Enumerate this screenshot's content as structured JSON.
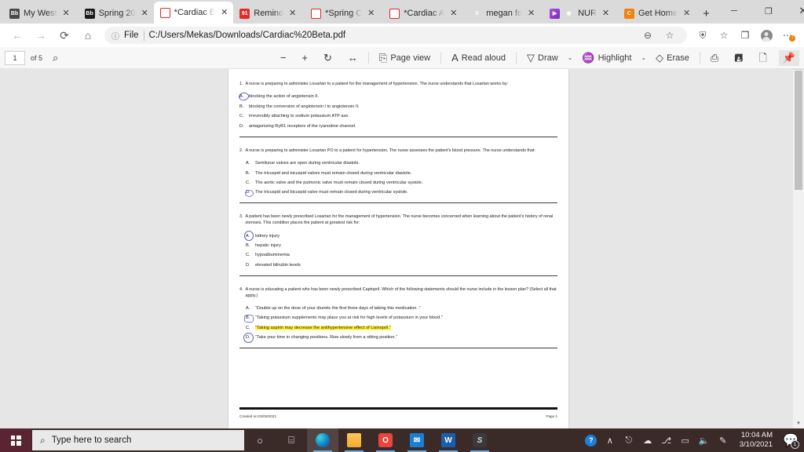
{
  "browser": {
    "tabs": [
      {
        "title": "My West ",
        "icon": "blackboard-icon",
        "icon_kind": "fav-bb-light",
        "icon_glyph": "Bb",
        "active": false
      },
      {
        "title": "Spring 20",
        "icon": "blackboard-icon",
        "icon_kind": "fav-bb-dark",
        "icon_glyph": "Bb",
        "active": false
      },
      {
        "title": "*Cardiac B",
        "icon": "pdf-icon",
        "icon_kind": "fav-pdf",
        "icon_glyph": "PDF",
        "active": true
      },
      {
        "title": "Remind",
        "icon": "remind-icon",
        "icon_kind": "fav-remind",
        "icon_glyph": "91",
        "active": false
      },
      {
        "title": "*Spring C",
        "icon": "pdf-icon",
        "icon_kind": "fav-pdf",
        "icon_glyph": "PDF",
        "active": false
      },
      {
        "title": "*Cardiac A",
        "icon": "pdf-icon",
        "icon_kind": "fav-pdf",
        "icon_glyph": "PDF",
        "active": false
      },
      {
        "title": "megan fo",
        "icon": "bing-icon",
        "icon_kind": "fav-bing",
        "icon_glyph": "b",
        "active": false
      },
      {
        "title": "NUR",
        "icon": "record-icon",
        "icon_kind": "fav-purple",
        "icon_glyph": "▶",
        "active": false
      },
      {
        "title": "Get Home",
        "icon": "chegg-icon",
        "icon_kind": "fav-orange",
        "icon_glyph": "C",
        "active": false
      }
    ],
    "new_tab_label": "+",
    "tab_close_label": "✕",
    "window": {
      "minimize": "─",
      "maximize": "❐",
      "close": "✕"
    },
    "nav": {
      "back": "←",
      "forward": "→",
      "refresh": "⟳",
      "home": "⌂"
    },
    "omnibox": {
      "info_icon": "ⓘ",
      "scheme_label": "File",
      "url": "C:/Users/Mekas/Downloads/Cardiac%20Beta.pdf",
      "zoom_out_icon": "⊖",
      "favorite_icon": "☆"
    },
    "toolbar_right": [
      {
        "name": "tracking-prevention-icon",
        "glyph": "⛨"
      },
      {
        "name": "favorites-icon",
        "glyph": "☆"
      },
      {
        "name": "collections-icon",
        "glyph": "❐"
      },
      {
        "name": "profile-avatar",
        "glyph": ""
      },
      {
        "name": "settings-more-icon",
        "glyph": "⋯"
      }
    ]
  },
  "pdf_toolbar": {
    "page_number": "1",
    "page_total": "of 5",
    "search_icon": "⌕",
    "zoom_out": "−",
    "zoom_in": "+",
    "rotate": "↻",
    "fit_page": "↔",
    "page_view_label": "Page view",
    "page_view_icon": "⎘",
    "read_aloud_label": "Read aloud",
    "read_aloud_icon": "A",
    "draw_label": "Draw",
    "draw_icon": "▽",
    "highlight_label": "Highlight",
    "highlight_icon": "♒",
    "erase_label": "Erase",
    "erase_icon": "◇",
    "print_icon": "⎙",
    "save_icon": "Ὃe",
    "save_as_icon": "✎",
    "pin_icon": "⚑",
    "chevron": "⌄"
  },
  "document": {
    "questions": [
      {
        "number": "1.",
        "stem": "A nurse is preparing to administer Losartan to a patient for the management of hypertension. The nurse understands that Losartan works by:",
        "choices": [
          {
            "label": "A.",
            "text": "blocking the action of angiotensin II.",
            "circled": true,
            "highlighted": false
          },
          {
            "label": "B.",
            "text": "blocking the conversion of angiotensin I to angiotensin II.",
            "circled": false,
            "highlighted": false
          },
          {
            "label": "C.",
            "text": "irreversibly attaching to sodium potassium ATP ase.",
            "circled": false,
            "highlighted": false
          },
          {
            "label": "D.",
            "text": "antagonizing RyR1 receptors of the ryanodine channel.",
            "circled": false,
            "highlighted": false
          }
        ]
      },
      {
        "number": "2.",
        "stem": "A nurse is preparing to administer Losartan PO to a patient for hypertension. The nurse assesses the patient's blood pressure. The nurse understands that:",
        "choices": [
          {
            "label": "A.",
            "text": "Semilunar valves are open during ventricular diastole.",
            "circled": false,
            "highlighted": false
          },
          {
            "label": "B.",
            "text": "The tricuspid and bicuspid valves must remain closed during ventricular diastole.",
            "circled": false,
            "highlighted": false
          },
          {
            "label": "C.",
            "text": "The aortic valve and the pulmonic valve must remain closed during ventricular systole.",
            "circled": false,
            "highlighted": false
          },
          {
            "label": "D.",
            "text": "The tricuspid and bicuspid valve must remain closed during ventricular systole.",
            "circled": true,
            "highlighted": false
          }
        ]
      },
      {
        "number": "3.",
        "stem": "A patient has been newly prescribed Losartan for the management of hypertension. The nurse becomes concerned when learning about the patient's history of renal stenosis. This condition places the patient at greatest risk for:",
        "choices": [
          {
            "label": "A.",
            "text": "kidney injury",
            "circled": true,
            "highlighted": false
          },
          {
            "label": "B.",
            "text": "hepatic injury",
            "circled": false,
            "highlighted": false
          },
          {
            "label": "C.",
            "text": "hypoalbuminemia",
            "circled": false,
            "highlighted": false
          },
          {
            "label": "D.",
            "text": "elevated bilirubin levels",
            "circled": false,
            "highlighted": false
          }
        ]
      },
      {
        "number": "4.",
        "stem": "A nurse is educating a patient who has been newly prescribed Captopril. Which of the following statements should the nurse include in the lesson plan? (Select all that apply.)",
        "choices": [
          {
            "label": "A.",
            "text": "“Double up on the dose of your diuretic the first three days of taking this medication .”",
            "circled": false,
            "highlighted": false
          },
          {
            "label": "B.",
            "text": "“Taking potassium supplements may place you at risk for high levels of potassium in your blood.”",
            "circled": true,
            "highlighted": false
          },
          {
            "label": "C.",
            "text": "“Taking aspirin may decrease the antihypertensive effect of Lisinopril.”",
            "circled": false,
            "highlighted": true
          },
          {
            "label": "D.",
            "text": "“Take your time in changing positions. Rise slowly from a sitting position.”",
            "circled": true,
            "highlighted": false
          }
        ]
      }
    ],
    "footer_left": "Created on:03/09/2021",
    "footer_right": "Page 1"
  },
  "taskbar": {
    "search_placeholder": "Type here to search",
    "search_icon": "⌕",
    "cortana_icon": "○",
    "taskview_icon": "⌸",
    "apps": [
      {
        "name": "edge",
        "glyph": "",
        "kind": "g-edge",
        "running": true,
        "active": true
      },
      {
        "name": "file-explorer",
        "glyph": "",
        "kind": "g-files",
        "running": true,
        "active": false
      },
      {
        "name": "office",
        "glyph": "O",
        "kind": "g-office",
        "running": true,
        "active": false
      },
      {
        "name": "mail",
        "glyph": "✉",
        "kind": "g-mail",
        "running": true,
        "active": false
      },
      {
        "name": "word",
        "glyph": "W",
        "kind": "g-word",
        "running": true,
        "active": false
      },
      {
        "name": "app-s",
        "glyph": "S",
        "kind": "g-s",
        "running": true,
        "active": false
      }
    ],
    "tray": {
      "help_icon": "?",
      "overflow_icon": "∧",
      "onedrive_icon": "☁",
      "display_icon": "⎋",
      "mic_icon": "⎇",
      "battery_icon": "▭",
      "volume_icon": "ὐa",
      "pen_icon": "✎",
      "time": "10:04 AM",
      "date": "3/10/2021",
      "notification_count": "1",
      "notification_icon": "☰"
    }
  },
  "colors": {
    "highlight": "#fff44f",
    "ink": "#5b61c4",
    "taskbar": "#3b2b28",
    "start": "#5b2433",
    "accent": "#0a78d2"
  }
}
